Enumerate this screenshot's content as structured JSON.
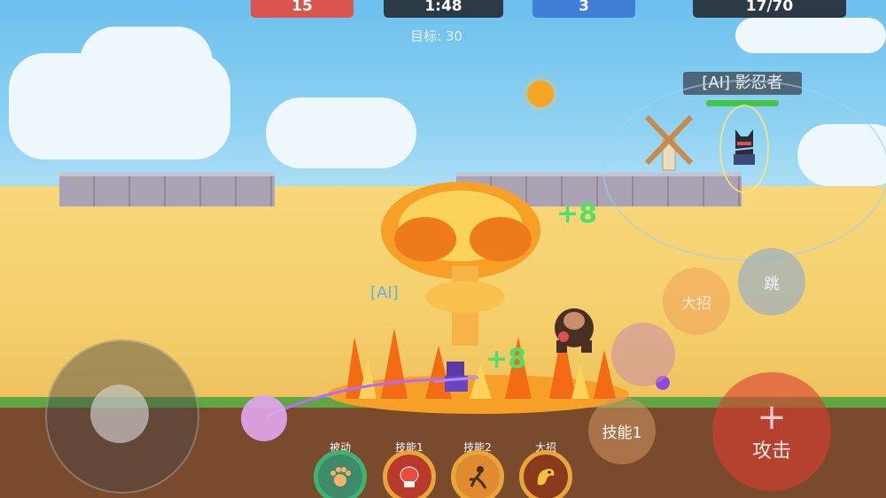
{
  "hud": {
    "red_score": "15",
    "timer": "1:48",
    "blue_score": "3",
    "kills": "17/70",
    "goal": "目标: 30"
  },
  "enemy": {
    "name_tag": "[AI] 影忍者",
    "partial_tag": "[AI]"
  },
  "effects": {
    "heal_text": "+8",
    "heal_text_2": "+8"
  },
  "controls": {
    "ultimate_label": "大招",
    "jump_label": "跳",
    "skill1_label": "技能1",
    "attack_label": "攻击"
  },
  "skills": [
    {
      "label": "被动",
      "icon": "paw-icon",
      "ring": "#3cb371"
    },
    {
      "label": "技能1",
      "icon": "boxing-glove-icon",
      "ring": "#e8a63a"
    },
    {
      "label": "技能2",
      "icon": "dash-runner-icon",
      "ring": "#e8a63a"
    },
    {
      "label": "大招",
      "icon": "dragon-icon",
      "ring": "#e8a63a"
    }
  ],
  "colors": {
    "red_team": "#d9534f",
    "blue_team": "#3f7fd8",
    "dark_panel": "#2b3a44",
    "health": "#43c544"
  }
}
